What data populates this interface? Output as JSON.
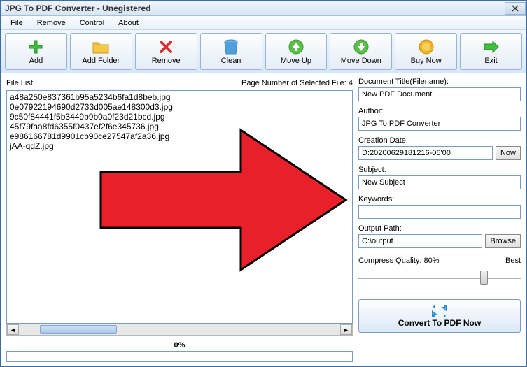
{
  "window": {
    "title": "JPG To PDF Converter - Unegistered"
  },
  "menu": {
    "file": "File",
    "remove": "Remove",
    "control": "Control",
    "about": "About"
  },
  "toolbar": {
    "add": "Add",
    "addFolder": "Add Folder",
    "remove": "Remove",
    "clean": "Clean",
    "moveUp": "Move Up",
    "moveDown": "Move Down",
    "buyNow": "Buy Now",
    "exit": "Exit"
  },
  "left": {
    "fileListLabel": "File List:",
    "pageInfo": "Page Number of Selected File: 4",
    "files": [
      "a48a250e837361b95a5234b6fa1d8beb.jpg",
      "0e07922194690d2733d005ae148300d3.jpg",
      "9c50f84441f5b3449b9b0a0f23d21bcd.jpg",
      "45f79faa8fd6355f0437ef2f6e345736.jpg",
      "e986166781d9901cb90ce27547af2a36.jpg",
      "jAA-qdZ.jpg"
    ],
    "progress": "0%"
  },
  "right": {
    "docTitle": {
      "label": "Document Title(Filename):",
      "value": "New PDF Document"
    },
    "author": {
      "label": "Author:",
      "value": "JPG To PDF Converter"
    },
    "creationDate": {
      "label": "Creation Date:",
      "value": "D:20200629181216-06'00",
      "nowBtn": "Now"
    },
    "subject": {
      "label": "Subject:",
      "value": "New Subject"
    },
    "keywords": {
      "label": "Keywords:",
      "value": ""
    },
    "outputPath": {
      "label": "Output Path:",
      "value": "C:\\output",
      "browseBtn": "Browse"
    },
    "quality": {
      "label": "Compress Quality: 80%",
      "best": "Best"
    },
    "convert": "Convert To PDF Now"
  }
}
